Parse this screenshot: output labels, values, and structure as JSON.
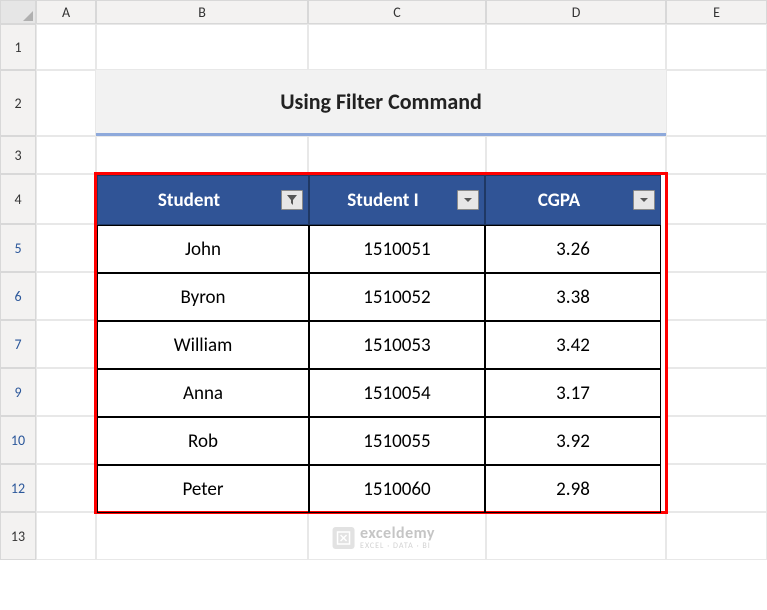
{
  "columns": [
    "A",
    "B",
    "C",
    "D",
    "E"
  ],
  "rows": [
    "1",
    "2",
    "3",
    "4",
    "5",
    "6",
    "7",
    "9",
    "10",
    "12",
    "13"
  ],
  "filtered_rows": [
    "5",
    "6",
    "7",
    "9",
    "10",
    "12"
  ],
  "title": "Using Filter Command",
  "headers": {
    "col1": "Student",
    "col2": "Student I",
    "col3": "CGPA"
  },
  "data_rows": [
    {
      "student": "John",
      "id": "1510051",
      "cgpa": "3.26"
    },
    {
      "student": "Byron",
      "id": "1510052",
      "cgpa": "3.38"
    },
    {
      "student": "William",
      "id": "1510053",
      "cgpa": "3.42"
    },
    {
      "student": "Anna",
      "id": "1510054",
      "cgpa": "3.17"
    },
    {
      "student": "Rob",
      "id": "1510055",
      "cgpa": "3.92"
    },
    {
      "student": "Peter",
      "id": "1510060",
      "cgpa": "2.98"
    }
  ],
  "watermark": {
    "main": "exceldemy",
    "sub": "EXCEL · DATA · BI"
  },
  "chart_data": {
    "type": "table",
    "title": "Using Filter Command",
    "columns": [
      "Student",
      "Student ID",
      "CGPA"
    ],
    "rows": [
      [
        "John",
        1510051,
        3.26
      ],
      [
        "Byron",
        1510052,
        3.38
      ],
      [
        "William",
        1510053,
        3.42
      ],
      [
        "Anna",
        1510054,
        3.17
      ],
      [
        "Rob",
        1510055,
        3.92
      ],
      [
        "Peter",
        1510060,
        2.98
      ]
    ]
  }
}
